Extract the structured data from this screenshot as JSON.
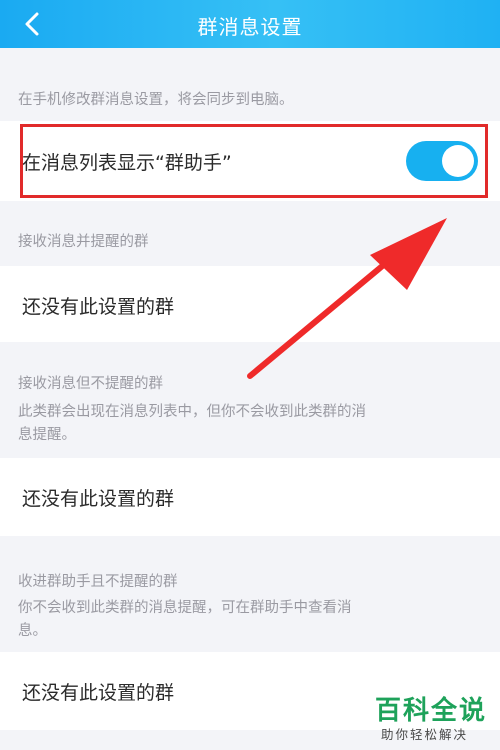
{
  "header": {
    "back_icon": "chevron-left-icon",
    "title": "群消息设置"
  },
  "sync_hint": "在手机修改群消息设置，将会同步到电脑。",
  "show_in_list": {
    "label": "在消息列表显示“群助手”",
    "toggle_on": true
  },
  "sections": [
    {
      "title": "接收消息并提醒的群",
      "description": "",
      "empty_text": "还没有此设置的群"
    },
    {
      "title": "接收消息但不提醒的群",
      "description_line1": "此类群会出现在消息列表中，但你不会收到此类群的消",
      "description_line2": "息提醒。",
      "empty_text": "还没有此设置的群"
    },
    {
      "title": "收进群助手且不提醒的群",
      "description_line1": "你不会收到此类群的消息提醒，可在群助手中查看消",
      "description_line2": "息。",
      "empty_text": "还没有此设置的群"
    }
  ],
  "watermark": {
    "title": "百科全说",
    "subtitle": "助你轻松解决"
  },
  "colors": {
    "header": "#1aaaf2",
    "toggle": "#17b0f0",
    "highlight": "#e12a2a",
    "watermark": "#1ea25a"
  }
}
